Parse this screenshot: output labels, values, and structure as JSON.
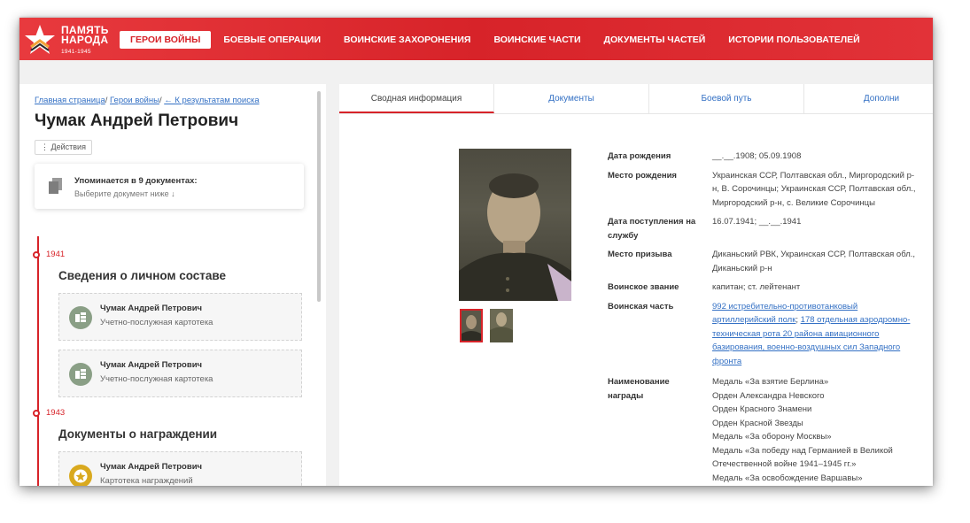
{
  "header": {
    "logo": {
      "line1": "ПАМЯТЬ",
      "line2": "НАРОДА",
      "years": "1941-1945"
    },
    "nav": [
      "ГЕРОИ ВОЙНЫ",
      "БОЕВЫЕ ОПЕРАЦИИ",
      "ВОИНСКИЕ ЗАХОРОНЕНИЯ",
      "ВОИНСКИЕ ЧАСТИ",
      "ДОКУМЕНТЫ ЧАСТЕЙ",
      "ИСТОРИИ ПОЛЬЗОВАТЕЛЕЙ"
    ],
    "active_nav": "ГЕРОИ ВОЙНЫ"
  },
  "breadcrumb": {
    "home": "Главная страница",
    "sep": "/",
    "heroes": "Герои войны",
    "back": "← К результатам поиска"
  },
  "person": {
    "name": "Чумак Андрей Петрович"
  },
  "actions_label": "Действия",
  "mentions": {
    "title": "Упоминается в 9 документах:",
    "subtitle": "Выберите документ ниже ↓"
  },
  "timeline": [
    {
      "year": "1941",
      "section": "Сведения о личном составе",
      "cards": [
        {
          "name": "Чумак Андрей Петрович",
          "type": "Учетно-послужная картотека"
        },
        {
          "name": "Чумак Андрей Петрович",
          "type": "Учетно-послужная картотека"
        }
      ]
    },
    {
      "year": "1943",
      "section": "Документы о награждении",
      "cards": [
        {
          "name": "Чумак Андрей Петрович",
          "type": "Картотека награждений"
        }
      ]
    }
  ],
  "tabs": [
    "Сводная информация",
    "Документы",
    "Боевой путь",
    "Дополни"
  ],
  "info": {
    "birth_date_label": "Дата рождения",
    "birth_date": "__.__.1908; 05.09.1908",
    "birth_place_label": "Место рождения",
    "birth_place": [
      "Украинская ССР, Полтавская обл., Миргородский р-",
      "н, В. Сорочинцы; Украинская ССР, Полтавская обл.,",
      "Миргородский р-н, с. Великие Сорочинцы"
    ],
    "service_date_label": [
      "Дата поступления на",
      "службу"
    ],
    "service_date": "16.07.1941; __.__.1941",
    "draft_place_label": "Место призыва",
    "draft_place": [
      "Диканьский РВК, Украинская ССР, Полтавская обл.,",
      "Диканьский р-н"
    ],
    "rank_label": "Воинское звание",
    "rank": "капитан; ст. лейтенант",
    "unit_label": "Воинская часть",
    "unit_link1": [
      "992 истребительно-противотанковый",
      "артиллерийский полк"
    ],
    "unit_sep": ";",
    "unit_link2_head": "178 отдельная аэродромно-",
    "unit_link2": [
      "техническая рота 20 района авиационного",
      "базирования, военно-воздушных сил Западного",
      "фронта"
    ],
    "awards_label": [
      "Наименование",
      "награды"
    ],
    "awards": [
      "Медаль «За взятие Берлина»",
      "Орден Александра Невского",
      "Орден Красного Знамени",
      "Орден Красной Звезды",
      "Медаль «За оборону Москвы»",
      "Медаль «За победу над Германией в Великой",
      "Отечественной войне 1941–1945 гг.»",
      "Медаль «За освобождение Варшавы»"
    ]
  },
  "colors": {
    "brand_red": "#d72329",
    "link_blue": "#3370c4"
  }
}
